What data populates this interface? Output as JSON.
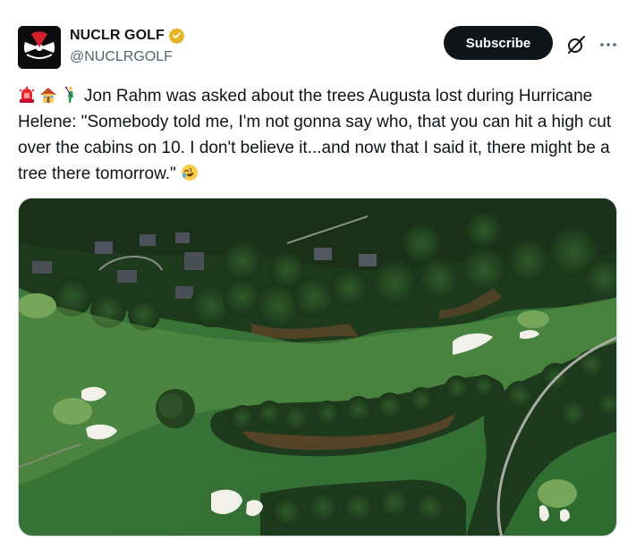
{
  "account": {
    "display_name": "NUCLR GOLF",
    "handle": "@NUCLRGOLF",
    "verified": true,
    "verified_color": "#e6b422",
    "avatar_icon": "nuclear-trefoil-logo"
  },
  "actions": {
    "subscribe_label": "Subscribe",
    "grok_icon": "grok-icon",
    "more_icon": "more-horizontal-icon"
  },
  "tweet": {
    "leading_emojis": [
      "rotating-light-emoji",
      "house-emoji",
      "golfer-emoji"
    ],
    "text": "Jon Rahm was asked about the trees Augusta lost during Hurricane Helene: \"Somebody told me, I'm not gonna say who, that you can hit a high cut over the cabins on 10. I don't believe it...and now that I said it, there might be a tree there tomorrow.\"",
    "trailing_emoji": "rolling-on-floor-laughing-emoji"
  },
  "media": {
    "type": "photo",
    "subject": "aerial-golf-course"
  },
  "colors": {
    "text": "#0f1419",
    "secondary": "#536471",
    "button_bg": "#0f1419",
    "button_text": "#ffffff",
    "border": "#cfd9de"
  }
}
